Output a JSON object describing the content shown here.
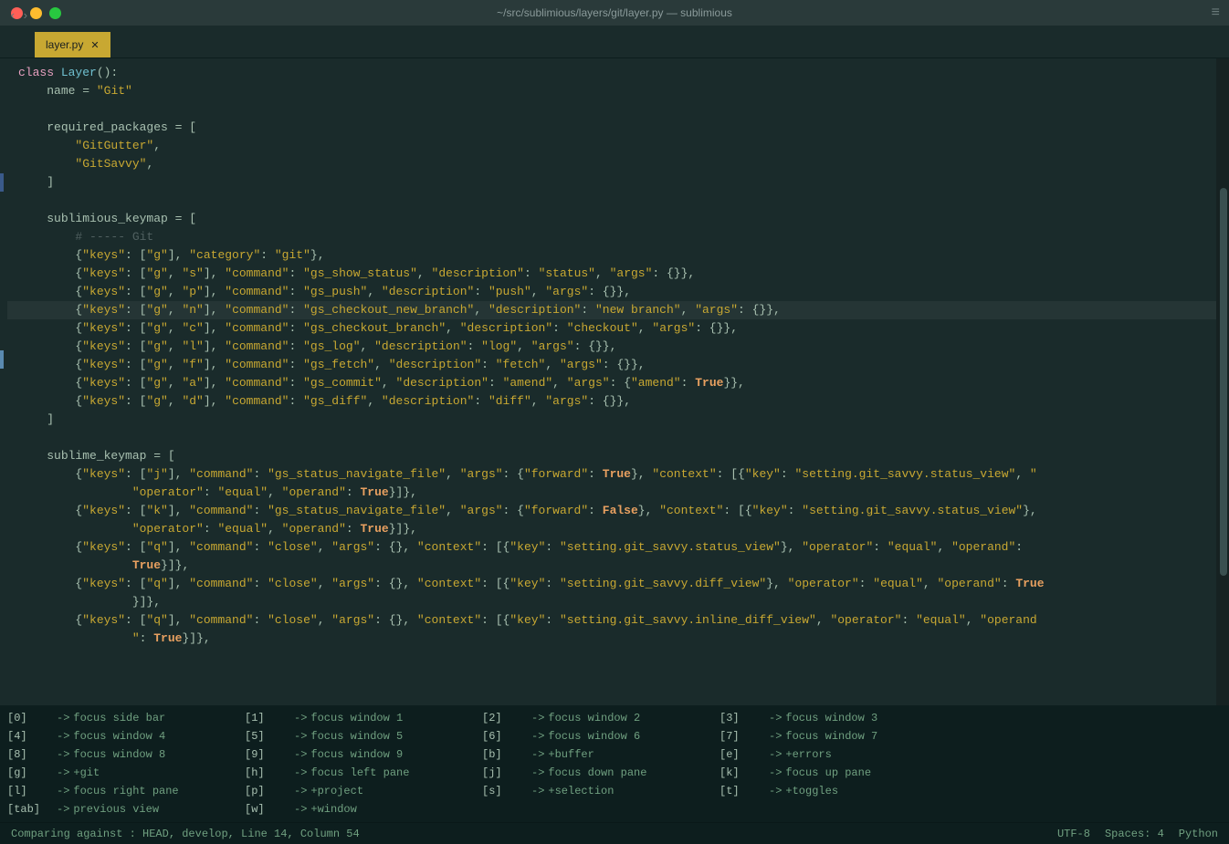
{
  "titlebar": {
    "title": "~/src/sublimious/layers/git/layer.py — sublimious",
    "buttons": [
      "close",
      "minimize",
      "maximize"
    ]
  },
  "tab": {
    "label": "layer.py",
    "close": "✕"
  },
  "statusbar": {
    "left": "Comparing against : HEAD, develop, Line 14, Column 54",
    "encoding": "UTF-8",
    "spaces": "Spaces: 4",
    "syntax": "Python"
  },
  "keybindings": [
    [
      "[0]",
      "focus side bar",
      "[1]",
      "focus window 1",
      "[2]",
      "focus window 2",
      "[3]",
      "focus window 3"
    ],
    [
      "[4]",
      "focus window 4",
      "[5]",
      "focus window 5",
      "[6]",
      "focus window 6",
      "[7]",
      "focus window 7"
    ],
    [
      "[8]",
      "focus window 8",
      "[9]",
      "focus window 9",
      "[b]",
      "+buffer",
      "[e]",
      "+errors"
    ],
    [
      "[g]",
      "+git",
      "[h]",
      "focus left pane",
      "[j]",
      "focus down pane",
      "[k]",
      "focus up pane"
    ],
    [
      "[l]",
      "focus right pane",
      "[p]",
      "+project",
      "[s]",
      "+selection",
      "[t]",
      "+toggles"
    ],
    [
      "[tab]",
      "previous view",
      "[w]",
      "+window",
      "",
      "",
      "",
      ""
    ]
  ]
}
